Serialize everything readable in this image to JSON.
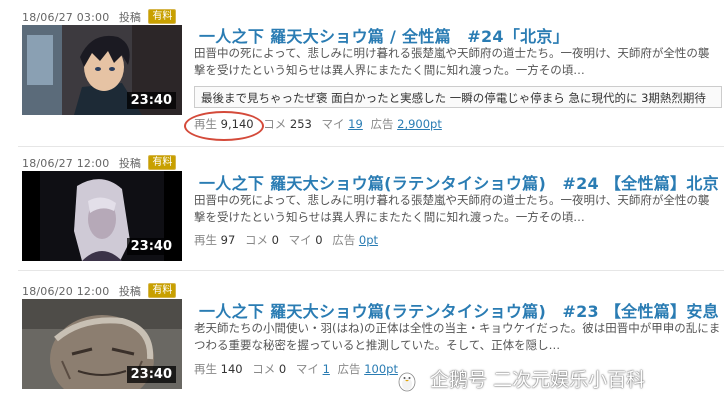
{
  "videos": [
    {
      "date": "18/06/27 03:00",
      "post_label": "投稿",
      "badge": "有料",
      "duration": "23:40",
      "title": "一人之下 羅天大ショウ篇 / 全性篇　#24「北京」",
      "desc_lines": [
        "田晋中の死によって、悲しみに明け暮れる張楚嵐や天師府の道士たち。一夜明け、天師府が全性の襲",
        "撃を受けたという知らせは異人界にまたたく間に知れ渡った。一方その頃…"
      ],
      "comment_text": "最後まで見ちゃったぜ褒 面白かったと実感した 一瞬の停電じゃ停まら 急に現代的に 3期熱烈期待",
      "stats": {
        "views_label": "再生",
        "views": "9,140",
        "comments_label": "コメ",
        "comments": "253",
        "mylist_label": "マイ",
        "mylist": "19",
        "ads_label": "広告",
        "ads": "2,900pt"
      }
    },
    {
      "date": "18/06/27 12:00",
      "post_label": "投稿",
      "badge": "有料",
      "duration": "23:40",
      "title": "一人之下 羅天大ショウ篇(ラテンタイショウ篇)　#24 【全性篇】北京",
      "desc_lines": [
        "田晋中の死によって、悲しみに明け暮れる張楚嵐や天師府の道士たち。一夜明け、天師府が全性の襲",
        "撃を受けたという知らせは異人界にまたたく間に知れ渡った。一方その頃…"
      ],
      "stats": {
        "views_label": "再生",
        "views": "97",
        "comments_label": "コメ",
        "comments": "0",
        "mylist_label": "マイ",
        "mylist": "0",
        "ads_label": "広告",
        "ads": "0pt"
      }
    },
    {
      "date": "18/06/20 12:00",
      "post_label": "投稿",
      "badge": "有料",
      "duration": "23:40",
      "title": "一人之下 羅天大ショウ篇(ラテンタイショウ篇)　#23 【全性篇】安息",
      "desc_lines": [
        "老天師たちの小間使い・羽(はね)の正体は全性の当主・キョウケイだった。彼は田晋中が甲申の乱にま",
        "つわる重要な秘密を握っていると推測していた。そして、正体を隠し…"
      ],
      "stats": {
        "views_label": "再生",
        "views": "140",
        "comments_label": "コメ",
        "comments": "0",
        "mylist_label": "マイ",
        "mylist": "1",
        "ads_label": "広告",
        "ads": "100pt"
      }
    }
  ],
  "watermark": {
    "text": "企鹅号 二次元娱乐小百科",
    "icon": "penguin-icon"
  },
  "colors": {
    "title": "#2a7cb3",
    "badge": "#c8a000",
    "highlight_circle": "#d44a3a"
  }
}
